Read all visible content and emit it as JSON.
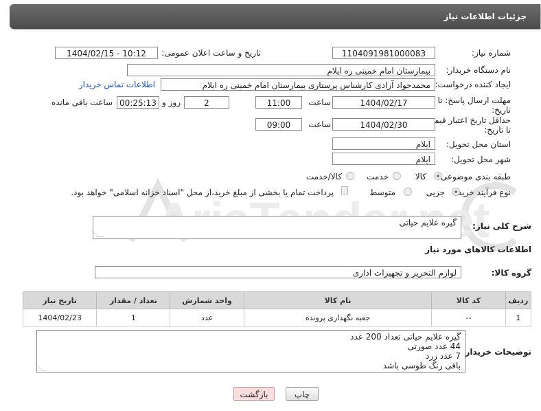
{
  "header": {
    "title": "جزئیات اطلاعات نیاز"
  },
  "fields": {
    "need_number_label": "شماره نیاز:",
    "need_number": "1104091981000083",
    "announce_label": "تاریخ و ساعت اعلان عمومی:",
    "announce_value": "1404/02/15 - 10:12",
    "buyer_org_label": "نام دستگاه خریدار:",
    "buyer_org": "بیمارستان امام خمینی  ره  ایلام",
    "requester_label": "ایجاد کننده درخواست:",
    "requester": "محمدجواد آزادی کارشناس پرستاری بیمارستان امام خمینی  ره  ایلام",
    "buyer_contact_link": "اطلاعات تماس خریدار",
    "deadline_label_1": "مهلت ارسال پاسخ: تا",
    "deadline_label_2": "تاریخ:",
    "deadline_date": "1404/02/17",
    "time_label": "ساعت",
    "deadline_time": "11:00",
    "days_value": "2",
    "days_label": "روز و",
    "remaining_time": "00:25:13",
    "remaining_label": "ساعت باقی مانده",
    "price_validity_label_1": "حداقل تاریخ اعتبار قیمت:",
    "price_validity_label_2": "تا تاریخ:",
    "price_validity_date": "1404/02/30",
    "price_validity_time": "09:00",
    "delivery_province_label": "استان محل تحویل:",
    "delivery_province": "ایلام",
    "delivery_city_label": "شهر محل تحویل:",
    "delivery_city": "ایلام",
    "category_label": "طبقه بندی موضوعی:",
    "category_options": [
      "کالا",
      "خدمت",
      "کالا/خدمت"
    ],
    "purchase_type_label": "نوع فرآیند خرید :",
    "purchase_options": [
      "جزیی",
      "متوسط"
    ],
    "payment_note": "پرداخت تمام یا بخشی از مبلغ خرید،از محل \"اسناد خزانه اسلامی\" خواهد بود."
  },
  "summary": {
    "label": "شرح کلی نیاز:",
    "value": "گیره علایم حیاتی"
  },
  "goods_info_title": "اطلاعات کالاهای مورد نیاز",
  "goods_group": {
    "label": "گروه کالا:",
    "value": "لوازم التحریر و تجهیزات اداری"
  },
  "table": {
    "headers": [
      "ردیف",
      "کد کالا",
      "نام کالا",
      "واحد شمارش",
      "تعداد / مقدار",
      "تاریخ نیاز"
    ],
    "rows": [
      [
        "1",
        "--",
        "جعبه نگهداری پرونده",
        "عدد",
        "1",
        "1404/02/23"
      ]
    ]
  },
  "buyer_notes": {
    "label": "توضیحات خریدار:",
    "lines": [
      "گیره علایم حیاتی تعداد 200 عدد",
      "44 عدد صورتی",
      "7 عدد زرد",
      "باقی رنگ طوسی باشد"
    ]
  },
  "buttons": {
    "print": "چاپ",
    "back": "بازگشت"
  },
  "watermark": "AriaTender.net",
  "colors": {
    "link": "#1a55c8",
    "header_bg": "#5a5a5a",
    "back_button_bg": "#f8dede"
  }
}
